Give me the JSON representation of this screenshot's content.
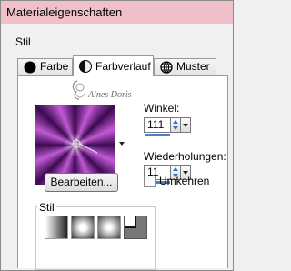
{
  "window": {
    "title": "Materialeigenschaften"
  },
  "group": {
    "label": "Stil"
  },
  "tabs": [
    {
      "label": "Farbe",
      "icon": "black-circle-icon"
    },
    {
      "label": "Farbverlauf",
      "icon": "gradient-circle-icon",
      "active": true
    },
    {
      "label": "Muster",
      "icon": "pattern-globe-icon"
    }
  ],
  "watermark": {
    "text": "Aines Doris"
  },
  "angle": {
    "label": "Winkel:",
    "value": "111"
  },
  "repeats": {
    "label": "Wiederholungen:",
    "value": "11"
  },
  "edit_button": {
    "label": "Bearbeiten..."
  },
  "invert": {
    "label": "Umkehren",
    "checked": false
  },
  "style_group": {
    "label": "Stil",
    "options": [
      "linear",
      "rectangular",
      "sunburst",
      "radial"
    ],
    "selected": "radial"
  },
  "colors": {
    "title_bar": "#efc0c9",
    "gradient_dark": "#3c0a52",
    "gradient_light": "#c05ad3",
    "spin_accent": "#4a7fd0"
  }
}
